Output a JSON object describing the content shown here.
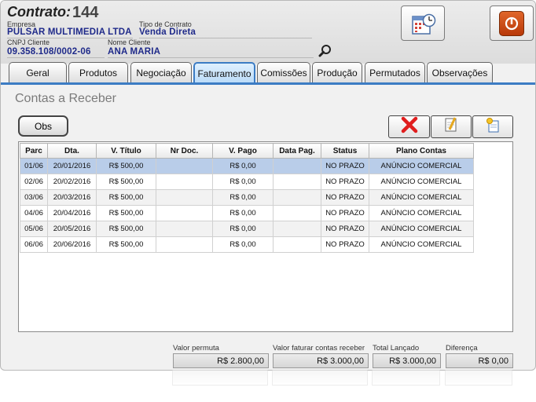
{
  "header": {
    "contract_label": "Contrato:",
    "contract_number": "144",
    "empresa_label": "Empresa",
    "empresa_value": "PULSAR MULTIMEDIA LTDA",
    "tipo_label": "Tipo de Contrato",
    "tipo_value": "Venda Direta",
    "cnpj_label": "CNPJ Cliente",
    "cnpj_value": "09.358.108/0002-06",
    "nome_label": "Nome Cliente",
    "nome_value": "ANA MARIA"
  },
  "tabs": [
    {
      "label": "Geral"
    },
    {
      "label": "Produtos"
    },
    {
      "label": "Negociação"
    },
    {
      "label": "Faturamento"
    },
    {
      "label": "Comissões"
    },
    {
      "label": "Produção"
    },
    {
      "label": "Permutados"
    },
    {
      "label": "Observações"
    }
  ],
  "active_tab": "Faturamento",
  "section_title": "Contas a Receber",
  "obs_button": "Obs",
  "table": {
    "columns": [
      "Parc",
      "Dta.",
      "V. Título",
      "Nr Doc.",
      "V. Pago",
      "Data Pag.",
      "Status",
      "Plano Contas"
    ],
    "rows": [
      [
        "01/06",
        "20/01/2016",
        "R$ 500,00",
        "",
        "R$ 0,00",
        "",
        "NO PRAZO",
        "ANÚNCIO COMERCIAL"
      ],
      [
        "02/06",
        "20/02/2016",
        "R$ 500,00",
        "",
        "R$ 0,00",
        "",
        "NO PRAZO",
        "ANÚNCIO COMERCIAL"
      ],
      [
        "03/06",
        "20/03/2016",
        "R$ 500,00",
        "",
        "R$ 0,00",
        "",
        "NO PRAZO",
        "ANÚNCIO COMERCIAL"
      ],
      [
        "04/06",
        "20/04/2016",
        "R$ 500,00",
        "",
        "R$ 0,00",
        "",
        "NO PRAZO",
        "ANÚNCIO COMERCIAL"
      ],
      [
        "05/06",
        "20/05/2016",
        "R$ 500,00",
        "",
        "R$ 0,00",
        "",
        "NO PRAZO",
        "ANÚNCIO COMERCIAL"
      ],
      [
        "06/06",
        "20/06/2016",
        "R$ 500,00",
        "",
        "R$ 0,00",
        "",
        "NO PRAZO",
        "ANÚNCIO COMERCIAL"
      ]
    ],
    "selected_row": 0
  },
  "footer": {
    "permuta_label": "Valor permuta",
    "permuta_value": "R$ 2.800,00",
    "faturar_label": "Valor faturar contas receber",
    "faturar_value": "R$ 3.000,00",
    "total_label": "Total Lançado",
    "total_value": "R$ 3.000,00",
    "diferenca_label": "Diferença",
    "diferenca_value": "R$ 0,00"
  },
  "colors": {
    "accent": "#3c7cc4",
    "value_text": "#1f2a8a",
    "selected_row": "#b9cde9",
    "power_button": "#c2410c"
  },
  "icons": [
    "search-icon",
    "calendar-clock-icon",
    "power-icon",
    "delete-icon",
    "edit-icon",
    "new-record-icon"
  ]
}
